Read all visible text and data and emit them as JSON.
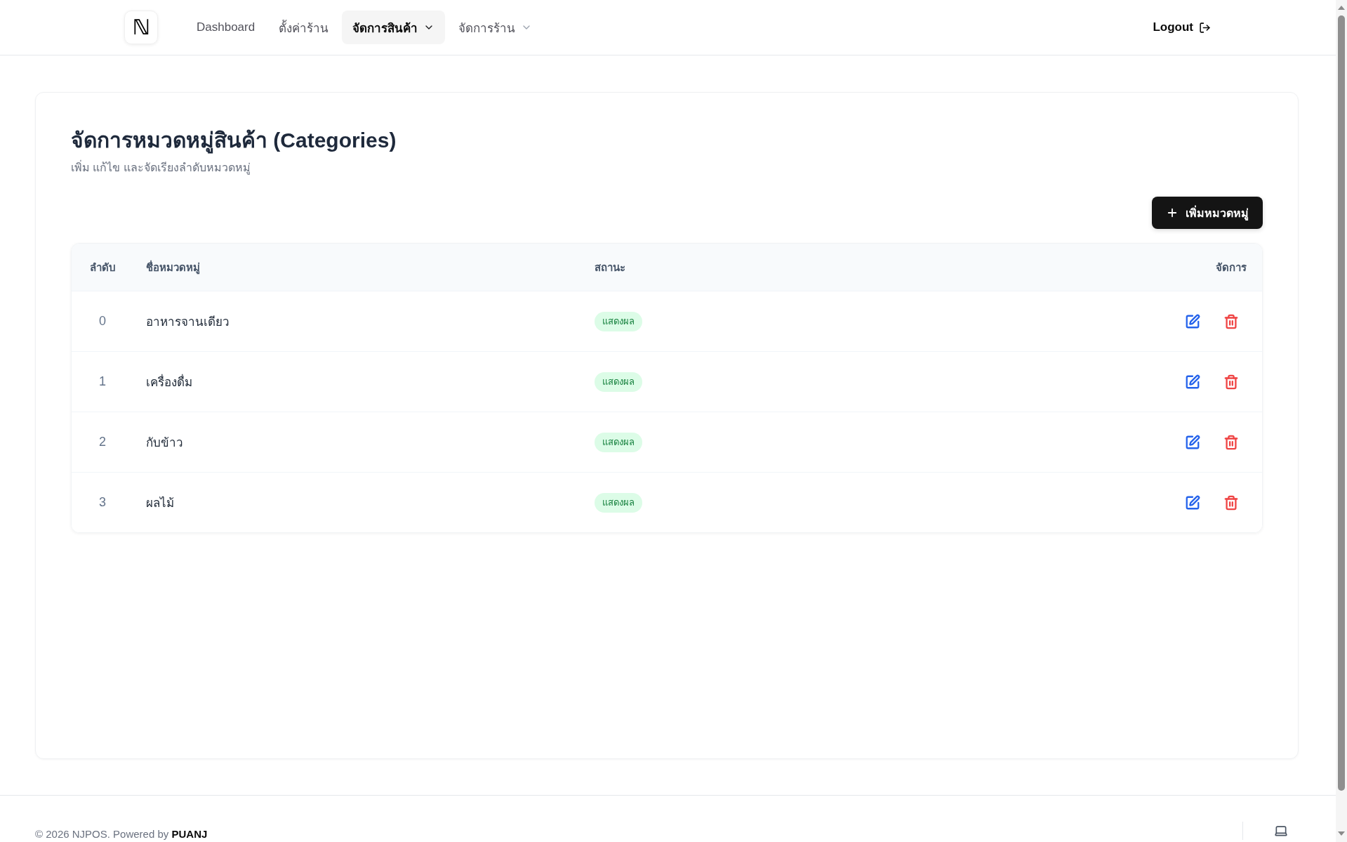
{
  "nav": {
    "logo": "ℕ",
    "items": [
      {
        "label": "Dashboard",
        "selected": false,
        "dropdown": false
      },
      {
        "label": "ตั้งค่าร้าน",
        "selected": false,
        "dropdown": false
      },
      {
        "label": "จัดการสินค้า",
        "selected": true,
        "dropdown": true
      },
      {
        "label": "จัดการร้าน",
        "selected": false,
        "dropdown": true
      }
    ],
    "logout": "Logout"
  },
  "page": {
    "title": "จัดการหมวดหมู่สินค้า (Categories)",
    "subtitle": "เพิ่ม แก้ไข และจัดเรียงลำดับหมวดหมู่",
    "add_button": "เพิ่มหมวดหมู่"
  },
  "table": {
    "columns": [
      "ลำดับ",
      "ชื่อหมวดหมู่",
      "สถานะ",
      "จัดการ"
    ],
    "rows": [
      {
        "order": "0",
        "name": "อาหารจานเดียว",
        "status": "แสดงผล"
      },
      {
        "order": "1",
        "name": "เครื่องดื่ม",
        "status": "แสดงผล"
      },
      {
        "order": "2",
        "name": "กับข้าว",
        "status": "แสดงผล"
      },
      {
        "order": "3",
        "name": "ผลไม้",
        "status": "แสดงผล"
      }
    ]
  },
  "footer": {
    "text": "© 2026 NJPOS. Powered by **PUANJ**"
  }
}
